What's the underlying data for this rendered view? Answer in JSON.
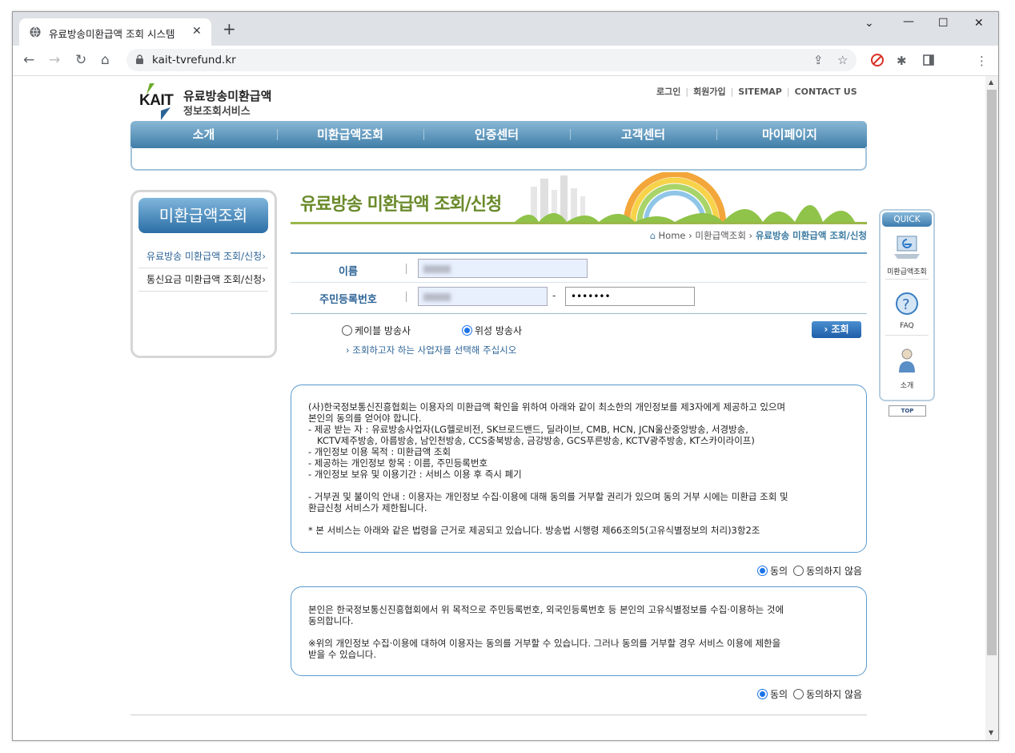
{
  "browser": {
    "tab_title": "유료방송미환급액 조회 시스템",
    "tab_close": "✕",
    "new_tab": "+",
    "url": "kait-tvrefund.kr",
    "win_min": "⌄",
    "win_restore": "—",
    "win_max": "☐",
    "win_close": "✕"
  },
  "header": {
    "logo_abbr": "KAIT",
    "logo_line1": "유료방송미환급액",
    "logo_line2": "정보조회서비스",
    "util_links": [
      "로그인",
      "회원가입",
      "SITEMAP",
      "CONTACT US"
    ]
  },
  "gnb": [
    "소개",
    "미환급액조회",
    "인증센터",
    "고객센터",
    "마이페이지"
  ],
  "lnb": {
    "title": "미환급액조회",
    "items": [
      "유료방송 미환급액 조회/신청",
      "통신요금 미환급액 조회/신청"
    ]
  },
  "banner": {
    "title": "유료방송 미환급액 조회/신청"
  },
  "breadcrumb": {
    "home": "Home",
    "level1": "미환급액조회",
    "current": "유료방송 미환급액 조회/신청"
  },
  "form": {
    "name_label": "이름",
    "rrn_label": "주민등록번호",
    "rrn_dash": "-",
    "rrn_back_value": "•••••••",
    "cable_label": "케이블 방송사",
    "cable_selected": false,
    "satellite_label": "위성 방송사",
    "satellite_selected": true,
    "hint": "조회하고자 하는 사업자를 선택해 주십시오",
    "search_button": "조회"
  },
  "consent1": {
    "text": "(사)한국정보통신진흥협회는 이용자의 미환급액 확인을 위하여 아래와 같이 최소한의 개인정보를 제3자에게 제공하고 있으며\n본인의 동의를 얻어야 합니다.\n- 제공 받는 자 : 유료방송사업자(LG헬로비전, SK브로드밴드, 딜라이브, CMB, HCN, JCN울산중앙방송, 서경방송,\n   KCTV제주방송, 아름방송, 남인천방송, CCS충북방송, 금강방송, GCS푸른방송, KCTV광주방송, KT스카이라이프)\n- 개인정보 이용 목적 : 미환급액 조회\n- 제공하는 개인정보 항목 : 이름, 주민등록번호\n- 개인정보 보유 및 이용기간 : 서비스 이용 후 즉시 폐기\n\n- 거부권 및 불이익 안내 : 이용자는 개인정보 수집·이용에 대해 동의를 거부할 권리가 있으며 동의 거부 시에는 미환급 조회 및\n환급신청 서비스가 제한됩니다.\n\n* 본 서비스는 아래와 같은 법령을 근거로 제공되고 있습니다. 방송법 시행령 제66조의5(고유식별정보의 처리)3항2조",
    "agree": "동의",
    "disagree": "동의하지 않음",
    "agreed": true
  },
  "consent2": {
    "text": "본인은 한국정보통신진흥협회에서 위 목적으로 주민등록번호, 외국인등록번호 등 본인의 고유식별정보를 수집·이용하는 것에\n동의합니다.\n\n※위의 개인정보 수집·이용에 대하여 이용자는 동의를 거부할 수 있습니다. 그러나 동의를 거부할 경우 서비스 이용에 제한을\n받을 수 있습니다.",
    "agree": "동의",
    "disagree": "동의하지 않음",
    "agreed": true
  },
  "quick": {
    "title": "QUICK",
    "items": [
      "미환급액조회",
      "FAQ",
      "소개"
    ],
    "top": "TOP"
  },
  "colors": {
    "brand_blue": "#2d6496",
    "nav_blue": "#3f7ea8",
    "green": "#6a8a2a"
  }
}
